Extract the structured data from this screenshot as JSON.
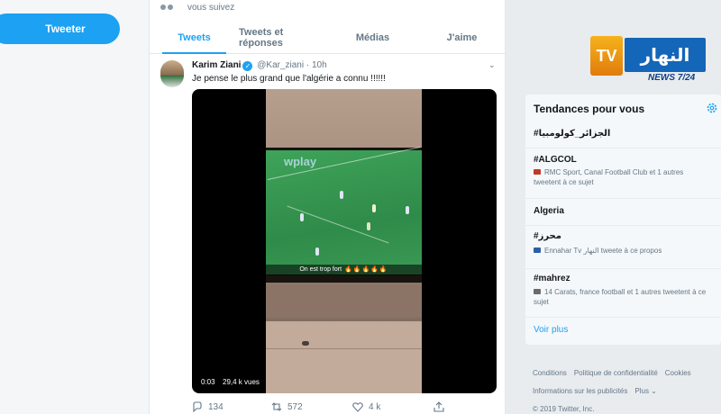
{
  "sidebar": {
    "tweet_button": "Tweeter"
  },
  "follow_note": "vous suivez",
  "tabs": [
    {
      "label": "Tweets",
      "active": true
    },
    {
      "label": "Tweets et réponses",
      "active": false
    },
    {
      "label": "Médias",
      "active": false
    },
    {
      "label": "J'aime",
      "active": false
    }
  ],
  "tweet": {
    "author_name": "Karim Ziani",
    "handle": "@Kar_ziani",
    "time": "· 10h",
    "text": "Je pense le plus grand que l'algérie a connu !!!!!!",
    "video": {
      "overlay_brand": "wplay",
      "caption": "On est trop fort",
      "caption_emoji": "🔥🔥🔥🔥🔥",
      "duration": "0:03",
      "views": "29,4 k vues"
    },
    "actions": {
      "replies": "134",
      "retweets": "572",
      "likes": "4 k"
    }
  },
  "logo": {
    "tv": "TV",
    "arabic": "النهار",
    "news": "NEWS 7/24"
  },
  "trends": {
    "title": "Tendances pour vous",
    "items": [
      {
        "name": "#الجزائر_كولومبيا",
        "meta": ""
      },
      {
        "name": "#ALGCOL",
        "meta": "RMC Sport, Canal Football Club et 1 autres tweetent à ce sujet"
      },
      {
        "name": "Algeria",
        "meta": ""
      },
      {
        "name": "#محرز",
        "meta": "Ennahar Tv النهار tweete à ce propos"
      },
      {
        "name": "#mahrez",
        "meta": "14 Carats, france football et 1 autres tweetent à ce sujet"
      }
    ],
    "more": "Voir plus"
  },
  "footer": {
    "links": [
      "Conditions",
      "Politique de confidentialité",
      "Cookies",
      "Informations sur les publicités",
      "Plus ⌄"
    ],
    "copyright": "© 2019 Twitter, Inc."
  },
  "colors": {
    "accent": "#1da1f2",
    "logo_orange": "#f6b21c",
    "logo_blue": "#1466b8"
  }
}
